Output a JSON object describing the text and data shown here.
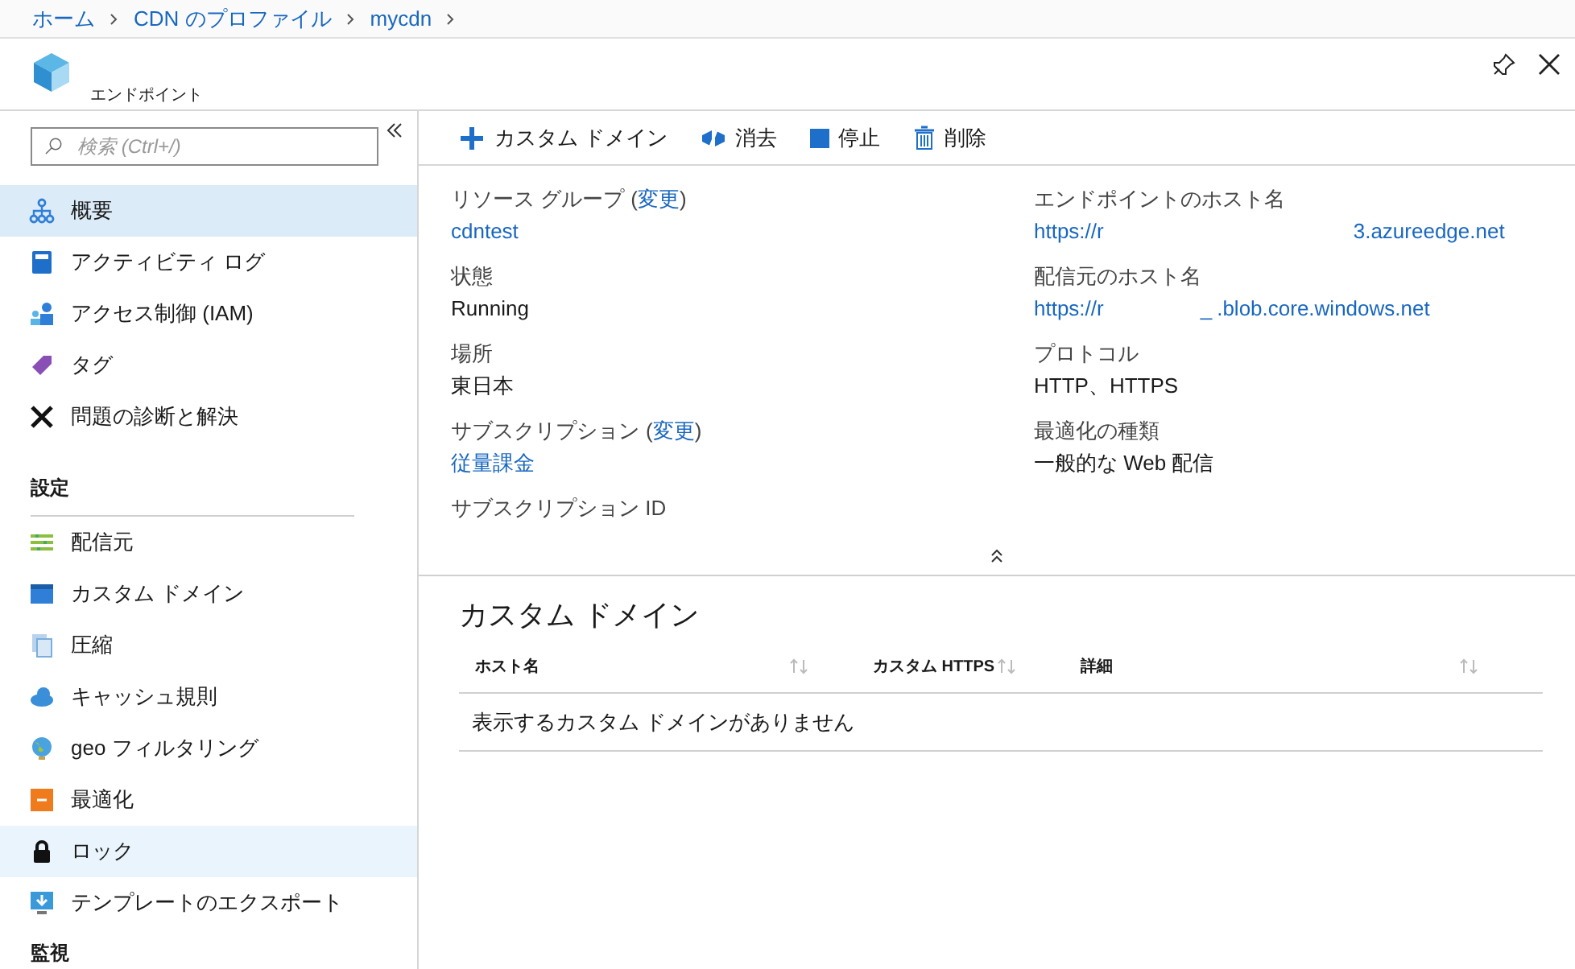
{
  "breadcrumb": [
    "ホーム",
    "CDN のプロファイル",
    "mycdn"
  ],
  "blade": {
    "title": "エンドポイント"
  },
  "search": {
    "placeholder": "検索 (Ctrl+/)"
  },
  "sidebar": [
    {
      "kind": "item",
      "label": "概要",
      "selected": true,
      "hovered": false
    },
    {
      "kind": "item",
      "label": "アクティビティ ログ",
      "selected": false,
      "hovered": false
    },
    {
      "kind": "item",
      "label": "アクセス制御 (IAM)",
      "selected": false,
      "hovered": false
    },
    {
      "kind": "item",
      "label": "タグ",
      "selected": false,
      "hovered": false
    },
    {
      "kind": "item",
      "label": "問題の診断と解決",
      "selected": false,
      "hovered": false
    },
    {
      "kind": "header",
      "label": "設定"
    },
    {
      "kind": "item",
      "label": "配信元",
      "selected": false,
      "hovered": false
    },
    {
      "kind": "item",
      "label": "カスタム ドメイン",
      "selected": false,
      "hovered": false
    },
    {
      "kind": "item",
      "label": "圧縮",
      "selected": false,
      "hovered": false
    },
    {
      "kind": "item",
      "label": "キャッシュ規則",
      "selected": false,
      "hovered": false
    },
    {
      "kind": "item",
      "label": "geo フィルタリング",
      "selected": false,
      "hovered": false
    },
    {
      "kind": "item",
      "label": "最適化",
      "selected": false,
      "hovered": false
    },
    {
      "kind": "item",
      "label": "ロック",
      "selected": false,
      "hovered": true
    },
    {
      "kind": "item",
      "label": "テンプレートのエクスポート",
      "selected": false,
      "hovered": false
    },
    {
      "kind": "header",
      "label": "監視"
    }
  ],
  "toolbar": [
    "カスタム ドメイン",
    "消去",
    "停止",
    "削除"
  ],
  "properties_left": [
    {
      "label": "リソース グループ",
      "paren_open": "(",
      "link": "変更",
      "paren_close": ")",
      "value": "cdntest",
      "value_link": true
    },
    {
      "label": "状態",
      "value": "Running",
      "value_link": false
    },
    {
      "label": "場所",
      "value": "東日本",
      "value_link": false
    },
    {
      "label": "サブスクリプション",
      "paren_open": "(",
      "link": "変更",
      "paren_close": ")",
      "value": "従量課金",
      "value_link": true
    },
    {
      "label": "サブスクリプション ID"
    }
  ],
  "properties_right": [
    {
      "label": "エンドポイントのホスト名",
      "value_parts": [
        "https://r",
        "3.azureedge.net"
      ],
      "value_link": true
    },
    {
      "label": "配信元のホスト名",
      "value_parts": [
        "https://r",
        "_",
        ".blob.core.windows.net"
      ],
      "value_link": true
    },
    {
      "label": "プロトコル",
      "value_parts": [
        "HTTP、HTTPS"
      ],
      "value_link": false
    },
    {
      "label": "最適化の種類",
      "value_parts": [
        "一般的な Web 配信"
      ],
      "value_link": false
    }
  ],
  "custom_domains": {
    "title": "カスタム ドメイン",
    "columns": [
      "ホスト名",
      "カスタム HTTPS",
      "詳細"
    ],
    "empty_message": "表示するカスタム ドメインがありません"
  }
}
